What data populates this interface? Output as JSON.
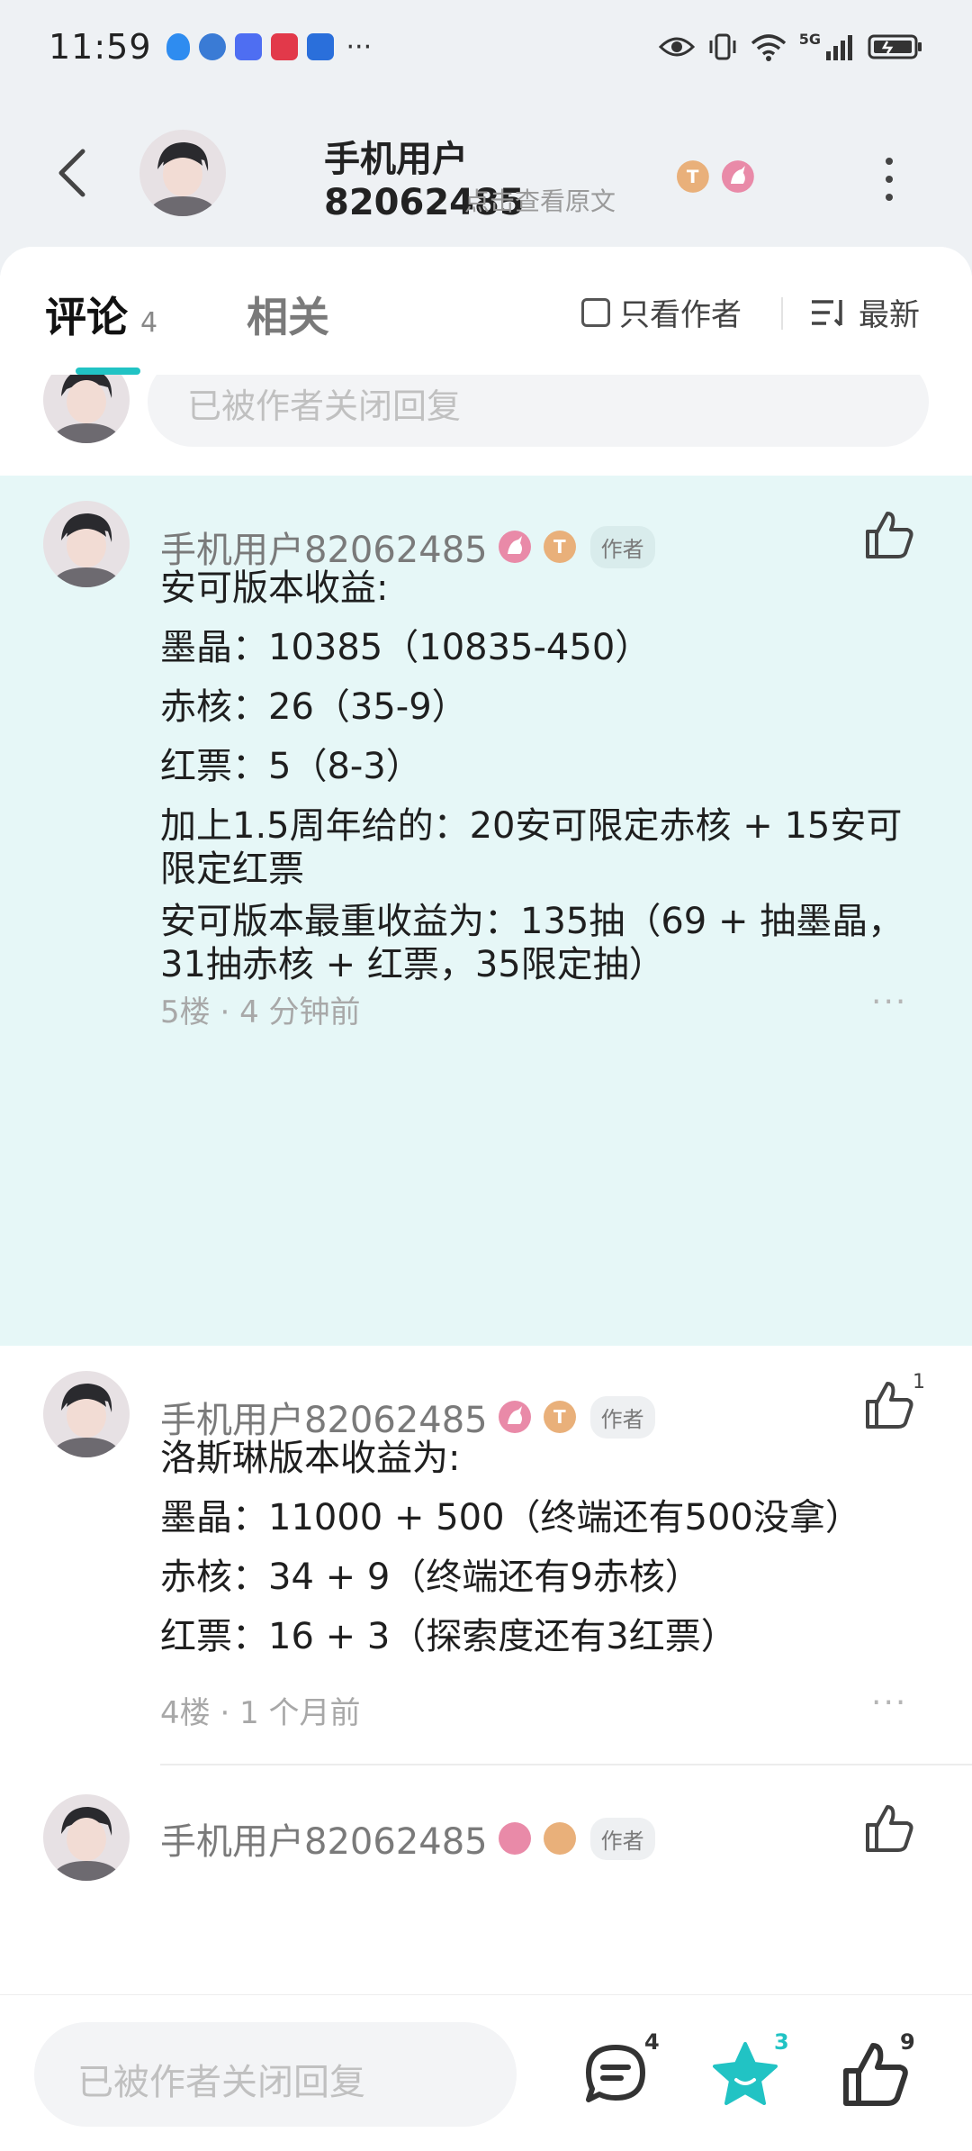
{
  "status_bar": {
    "time": "11:59",
    "more": "···",
    "network_label": "5G"
  },
  "header": {
    "title": "手机用户82062485",
    "subtitle": "点击查看原文"
  },
  "tabs": {
    "comments_label": "评论",
    "comments_count": "4",
    "related_label": "相关",
    "author_only_label": "只看作者",
    "sort_label": "最新"
  },
  "partial_reply_placeholder": "已被作者关闭回复",
  "comments": [
    {
      "user": "手机用户82062485",
      "author_tag": "作者",
      "lines": [
        "安可版本收益:",
        "墨晶：10385（10835-450）",
        "赤核：26（35-9）",
        "红票：5（8-3）",
        "加上1.5周年给的：20安可限定赤核 + 15安可",
        "限定红票",
        "安可版本最重收益为：135抽（69 + 抽墨晶，",
        "31抽赤核 + 红票，35限定抽）"
      ],
      "floor": "5楼",
      "time": "4 分钟前",
      "likes": ""
    },
    {
      "user": "手机用户82062485",
      "author_tag": "作者",
      "lines": [
        "洛斯琳版本收益为:",
        "墨晶：11000 + 500（终端还有500没拿）",
        "赤核：34 + 9（终端还有9赤核）",
        "红票：16 + 3（探索度还有3红票）"
      ],
      "floor": "4楼",
      "time": "1 个月前",
      "likes": "1"
    },
    {
      "user": "手机用户82062485",
      "author_tag": "作者"
    }
  ],
  "bottom_bar": {
    "reply_placeholder": "已被作者关闭回复",
    "comment_count": "4",
    "favorite_count": "3",
    "like_count": "9"
  },
  "colors": {
    "accent": "#21c3c4",
    "highlight_bg": "#e6f7f7",
    "badge_gold": "#e9b07a",
    "badge_pink": "#e98aa8"
  }
}
